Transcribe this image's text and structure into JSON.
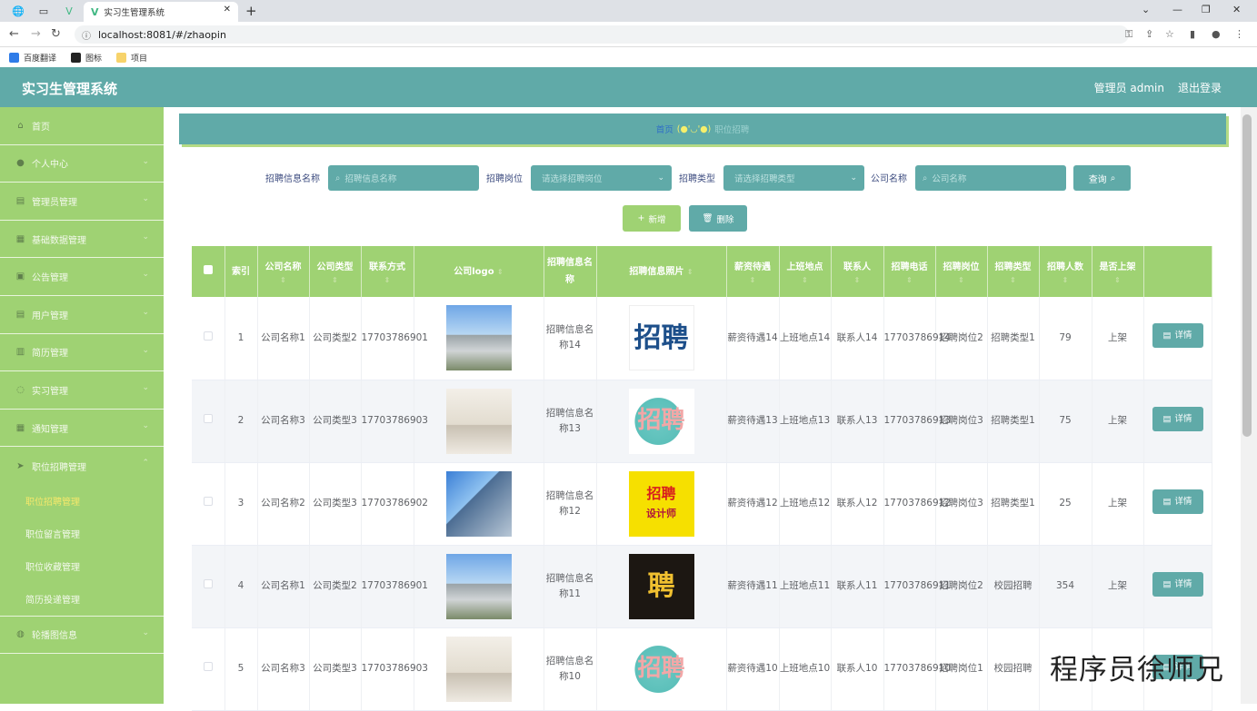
{
  "browser": {
    "tab_title": "实习生管理系统",
    "url": "localhost:8081/#/zhaopin",
    "bookmarks": [
      "百度翻译",
      "图标",
      "项目"
    ]
  },
  "header": {
    "title": "实习生管理系统",
    "admin": "管理员 admin",
    "logout": "退出登录"
  },
  "sidebar": {
    "items": [
      {
        "label": "首页",
        "icon": "home-icon"
      },
      {
        "label": "个人中心",
        "icon": "user-icon"
      },
      {
        "label": "管理员管理",
        "icon": "doc-icon"
      },
      {
        "label": "基础数据管理",
        "icon": "box-icon"
      },
      {
        "label": "公告管理",
        "icon": "notice-icon"
      },
      {
        "label": "用户管理",
        "icon": "users-icon"
      },
      {
        "label": "简历管理",
        "icon": "resume-icon"
      },
      {
        "label": "实习管理",
        "icon": "loading-icon"
      },
      {
        "label": "通知管理",
        "icon": "bell-icon"
      },
      {
        "label": "职位招聘管理",
        "icon": "send-icon"
      }
    ],
    "sub_items": [
      "职位招聘管理",
      "职位留言管理",
      "职位收藏管理",
      "简历投递管理"
    ],
    "last_item": {
      "label": "轮播图信息",
      "icon": "mic-icon"
    }
  },
  "breadcrumb": {
    "home": "首页",
    "face": "(●'◡'●)",
    "current": "职位招聘"
  },
  "search": {
    "name_label": "招聘信息名称",
    "name_placeholder": "招聘信息名称",
    "post_label": "招聘岗位",
    "post_placeholder": "请选择招聘岗位",
    "type_label": "招聘类型",
    "type_placeholder": "请选择招聘类型",
    "company_label": "公司名称",
    "company_placeholder": "公司名称",
    "query": "查询"
  },
  "actions": {
    "add": "新增",
    "delete": "删除"
  },
  "table": {
    "headers": [
      "索引",
      "公司名称",
      "公司类型",
      "联系方式",
      "公司logo",
      "招聘信息名称",
      "招聘信息照片",
      "薪资待遇",
      "上班地点",
      "联系人",
      "招聘电话",
      "招聘岗位",
      "招聘类型",
      "招聘人数",
      "是否上架"
    ],
    "detail_label": "详情",
    "rows": [
      {
        "index": "1",
        "company": "公司名称1",
        "ctype": "公司类型2",
        "phone": "17703786901",
        "title": "招聘信息名称14",
        "salary": "薪资待遇14",
        "place": "上班地点14",
        "contact": "联系人14",
        "tel": "17703786914",
        "post": "招聘岗位2",
        "rtype": "招聘类型1",
        "count": "79",
        "status": "上架"
      },
      {
        "index": "2",
        "company": "公司名称3",
        "ctype": "公司类型3",
        "phone": "17703786903",
        "title": "招聘信息名称13",
        "salary": "薪资待遇13",
        "place": "上班地点13",
        "contact": "联系人13",
        "tel": "17703786913",
        "post": "招聘岗位3",
        "rtype": "招聘类型1",
        "count": "75",
        "status": "上架"
      },
      {
        "index": "3",
        "company": "公司名称2",
        "ctype": "公司类型3",
        "phone": "17703786902",
        "title": "招聘信息名称12",
        "salary": "薪资待遇12",
        "place": "上班地点12",
        "contact": "联系人12",
        "tel": "17703786912",
        "post": "招聘岗位3",
        "rtype": "招聘类型1",
        "count": "25",
        "status": "上架"
      },
      {
        "index": "4",
        "company": "公司名称1",
        "ctype": "公司类型2",
        "phone": "17703786901",
        "title": "招聘信息名称11",
        "salary": "薪资待遇11",
        "place": "上班地点11",
        "contact": "联系人11",
        "tel": "17703786911",
        "post": "招聘岗位2",
        "rtype": "校园招聘",
        "count": "354",
        "status": "上架"
      },
      {
        "index": "5",
        "company": "公司名称3",
        "ctype": "公司类型3",
        "phone": "17703786903",
        "title": "招聘信息名称10",
        "salary": "薪资待遇10",
        "place": "上班地点10",
        "contact": "联系人10",
        "tel": "17703786910",
        "post": "招聘岗位1",
        "rtype": "校园招聘",
        "count": "",
        "status": ""
      }
    ],
    "poster_text": {
      "p1": "招聘",
      "p2": "招聘",
      "p3_top": "招聘",
      "p3_bottom": "设计师",
      "p4": "聘"
    }
  },
  "watermark": "程序员徐师兄",
  "colors": {
    "teal": "#60aaa8",
    "green": "#9fd273",
    "header_text": "#ffffff"
  }
}
